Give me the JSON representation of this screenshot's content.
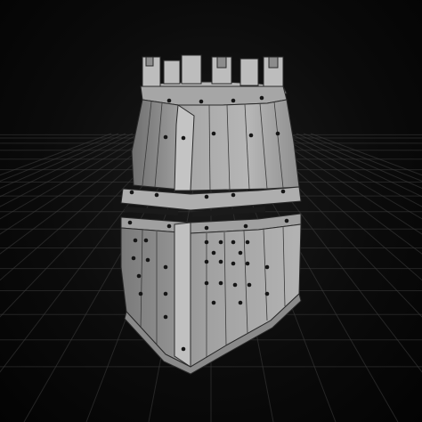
{
  "viewport": {
    "background": "#0b0b0b",
    "grid_color": "#3a3a3a"
  },
  "model": {
    "name": "great-helm",
    "surface_color": "#9a9a9a",
    "wire_color": "#2a2a2a",
    "rivet_color": "#151515"
  }
}
